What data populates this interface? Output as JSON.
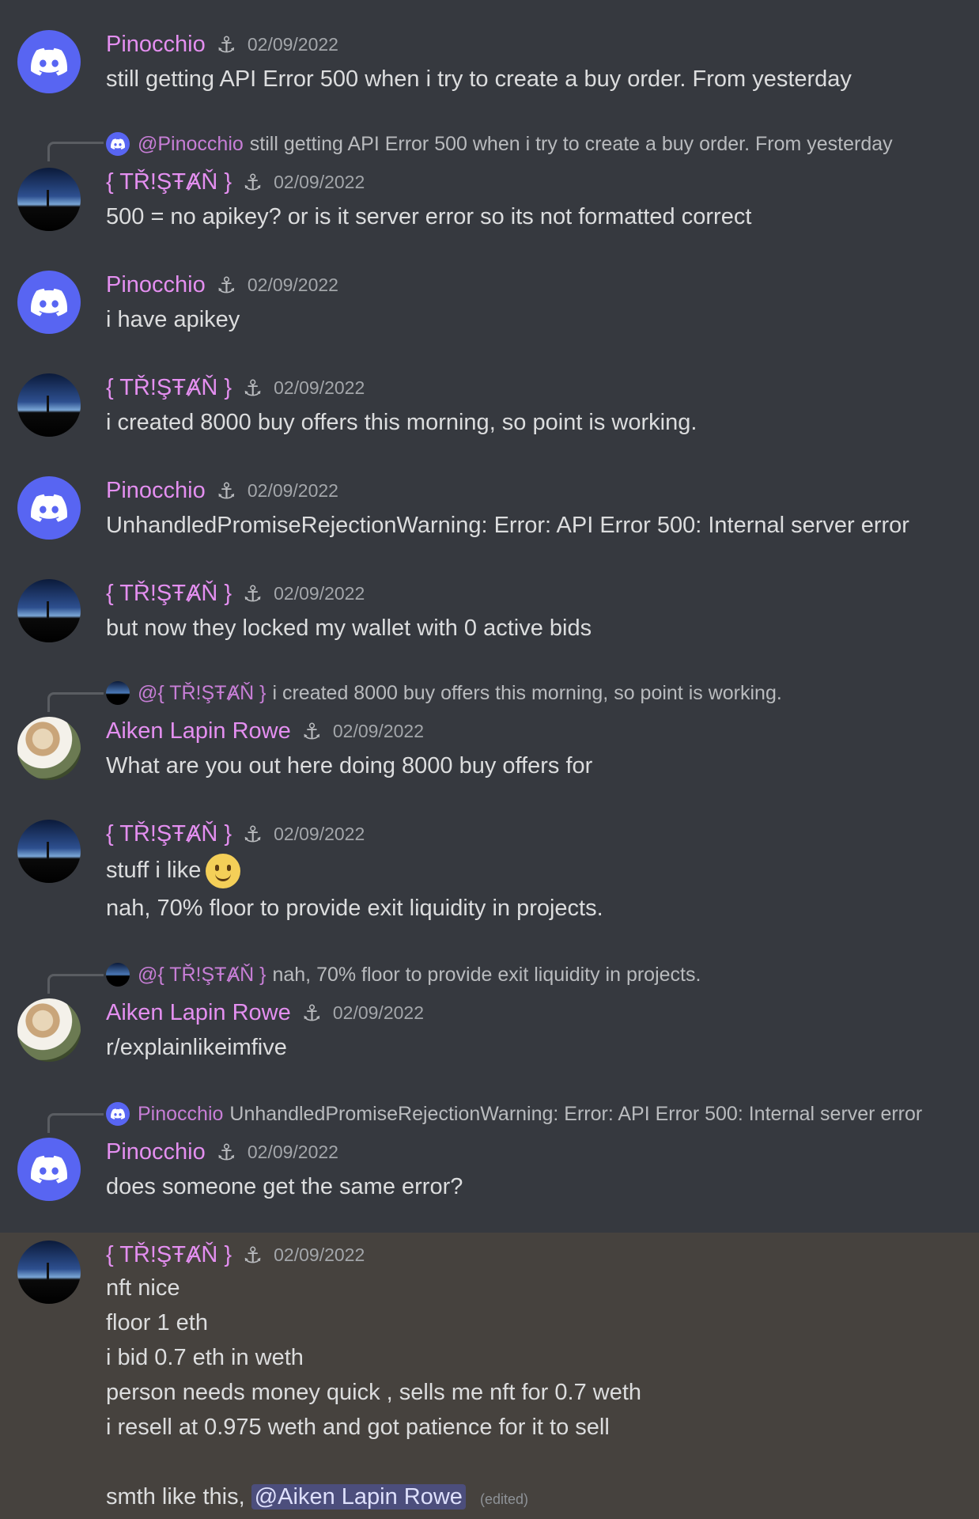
{
  "messages": [
    {
      "author": "Pinocchio",
      "timestamp": "02/09/2022",
      "anchor": "⚓",
      "lines": [
        "still getting API Error 500 when i try to create a buy order. From yesterday"
      ]
    },
    {
      "reply": {
        "name": "@Pinocchio",
        "text": "still getting API Error 500 when i try to create a buy order. From yesterday"
      },
      "author": "{ TŘ!ŞŦȺŇ }",
      "timestamp": "02/09/2022",
      "anchor": "⚓",
      "lines": [
        "500 = no apikey? or is it server error so its not formatted correct"
      ]
    },
    {
      "author": "Pinocchio",
      "timestamp": "02/09/2022",
      "anchor": "⚓",
      "lines": [
        "i have apikey"
      ]
    },
    {
      "author": "{ TŘ!ŞŦȺŇ }",
      "timestamp": "02/09/2022",
      "anchor": "⚓",
      "lines": [
        "i created 8000 buy offers this morning, so point is working."
      ]
    },
    {
      "author": "Pinocchio",
      "timestamp": "02/09/2022",
      "anchor": "⚓",
      "lines": [
        "UnhandledPromiseRejectionWarning: Error: API Error 500: Internal server error"
      ]
    },
    {
      "author": "{ TŘ!ŞŦȺŇ }",
      "timestamp": "02/09/2022",
      "anchor": "⚓",
      "lines": [
        "but now they locked my wallet with 0 active bids"
      ]
    },
    {
      "reply": {
        "name": "@{ TŘ!ŞŦȺŇ }",
        "text": "i created 8000 buy offers this morning, so point is working."
      },
      "author": "Aiken Lapin Rowe",
      "timestamp": "02/09/2022",
      "anchor": "⚓",
      "lines": [
        "What are you out here doing 8000 buy offers for"
      ]
    },
    {
      "author": "{ TŘ!ŞŦȺŇ }",
      "timestamp": "02/09/2022",
      "anchor": "⚓",
      "lines": [
        "stuff i like",
        "nah, 70% floor to provide exit liquidity in projects."
      ],
      "emoji": "slightly-smiling-face-emoji"
    },
    {
      "reply": {
        "name": "@{ TŘ!ŞŦȺŇ }",
        "text": "nah, 70% floor to provide exit liquidity in projects."
      },
      "author": "Aiken Lapin Rowe",
      "timestamp": "02/09/2022",
      "anchor": "⚓",
      "lines": [
        "r/explainlikeimfive"
      ]
    },
    {
      "reply": {
        "name": "Pinocchio",
        "text": "UnhandledPromiseRejectionWarning: Error: API Error 500: Internal server error"
      },
      "author": "Pinocchio",
      "timestamp": "02/09/2022",
      "anchor": "⚓",
      "lines": [
        "does someone get the same error?"
      ]
    },
    {
      "author": "{ TŘ!ŞŦȺŇ }",
      "timestamp": "02/09/2022",
      "anchor": "⚓",
      "lines": [
        "nft nice",
        "floor 1 eth",
        "i bid 0.7 eth in weth",
        "person needs money quick , sells me nft for 0.7 weth",
        "i resell at 0.975 weth and got patience for it to sell",
        "",
        "smth like this,"
      ],
      "mention": "@Aiken Lapin Rowe",
      "edited": "(edited)"
    }
  ]
}
